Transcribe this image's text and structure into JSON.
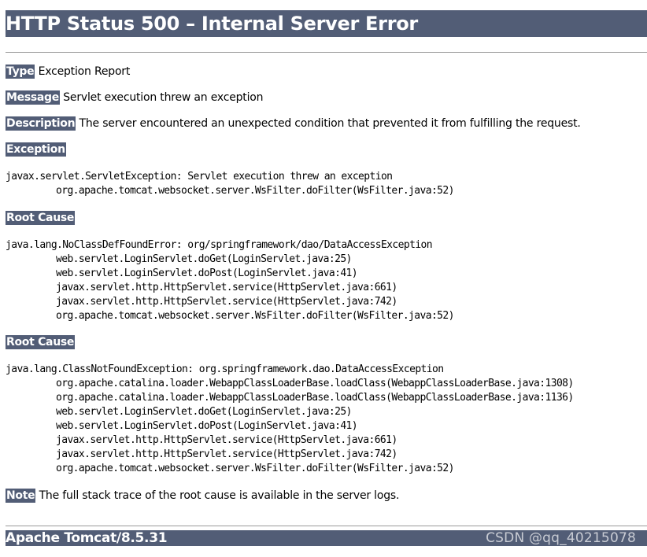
{
  "title": "HTTP Status 500 – Internal Server Error",
  "sections": {
    "type": {
      "label": "Type",
      "text": " Exception Report"
    },
    "message": {
      "label": "Message",
      "text": " Servlet execution threw an exception"
    },
    "description": {
      "label": "Description",
      "text": " The server encountered an unexpected condition that prevented it from fulfilling the request."
    },
    "exception": {
      "label": "Exception",
      "lines": [
        "javax.servlet.ServletException: Servlet execution threw an exception",
        "org.apache.tomcat.websocket.server.WsFilter.doFilter(WsFilter.java:52)"
      ]
    },
    "root_cause_1": {
      "label": "Root Cause",
      "lines": [
        "java.lang.NoClassDefFoundError: org/springframework/dao/DataAccessException",
        "web.servlet.LoginServlet.doGet(LoginServlet.java:25)",
        "web.servlet.LoginServlet.doPost(LoginServlet.java:41)",
        "javax.servlet.http.HttpServlet.service(HttpServlet.java:661)",
        "javax.servlet.http.HttpServlet.service(HttpServlet.java:742)",
        "org.apache.tomcat.websocket.server.WsFilter.doFilter(WsFilter.java:52)"
      ]
    },
    "root_cause_2": {
      "label": "Root Cause",
      "lines": [
        "java.lang.ClassNotFoundException: org.springframework.dao.DataAccessException",
        "org.apache.catalina.loader.WebappClassLoaderBase.loadClass(WebappClassLoaderBase.java:1308)",
        "org.apache.catalina.loader.WebappClassLoaderBase.loadClass(WebappClassLoaderBase.java:1136)",
        "web.servlet.LoginServlet.doGet(LoginServlet.java:25)",
        "web.servlet.LoginServlet.doPost(LoginServlet.java:41)",
        "javax.servlet.http.HttpServlet.service(HttpServlet.java:661)",
        "javax.servlet.http.HttpServlet.service(HttpServlet.java:742)",
        "org.apache.tomcat.websocket.server.WsFilter.doFilter(WsFilter.java:52)"
      ]
    },
    "note": {
      "label": "Note",
      "text": " The full stack trace of the root cause is available in the server logs."
    }
  },
  "footer": {
    "server": "Apache Tomcat/8.5.31",
    "watermark": "CSDN @qq_40215078"
  },
  "colors": {
    "header_bg": "#525d76",
    "header_text": "#ffffff",
    "body_text": "#000000"
  }
}
